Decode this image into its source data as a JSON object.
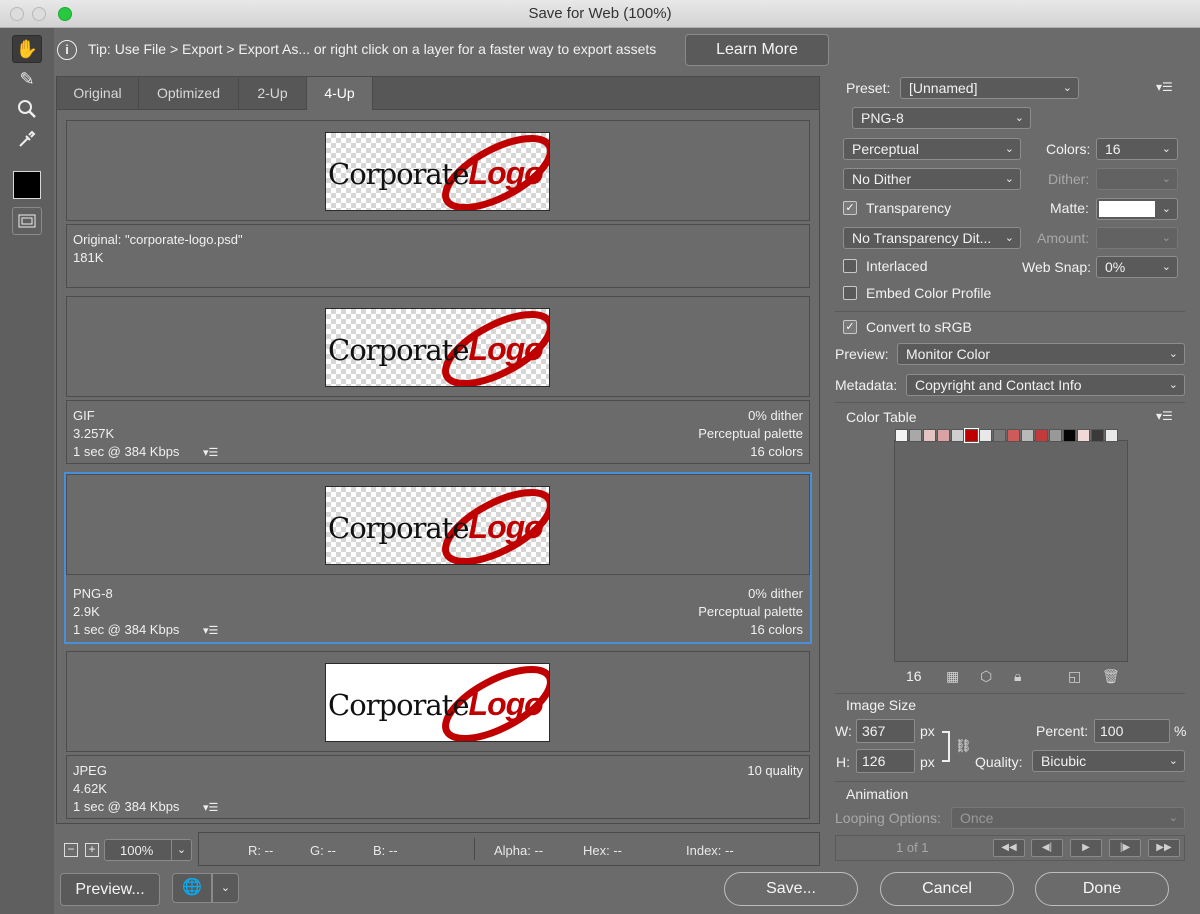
{
  "window": {
    "title": "Save for Web (100%)"
  },
  "tools": [
    "hand-tool-icon",
    "slice-select-tool-icon",
    "zoom-tool-icon",
    "eyedropper-tool-icon"
  ],
  "tip": {
    "text": "Tip: Use File > Export > Export As...  or right click on a layer for a faster way to export assets",
    "learn_more": "Learn More"
  },
  "tabs": [
    "Original",
    "Optimized",
    "2-Up",
    "4-Up"
  ],
  "active_tab": "4-Up",
  "panes": [
    {
      "logo_text_a": "Corporate",
      "logo_text_b": "Logo",
      "left": [
        "Original: \"corporate-logo.psd\"",
        "181K",
        ""
      ],
      "right": [
        "",
        "",
        ""
      ]
    },
    {
      "logo_text_a": "Corporate",
      "logo_text_b": "Logo",
      "left": [
        "GIF",
        "3.257K",
        "1 sec @ 384 Kbps"
      ],
      "right": [
        "0% dither",
        "Perceptual palette",
        "16 colors"
      ]
    },
    {
      "logo_text_a": "Corporate",
      "logo_text_b": "Logo",
      "left": [
        "PNG-8",
        "2.9K",
        "1 sec @ 384 Kbps"
      ],
      "right": [
        "0% dither",
        "Perceptual palette",
        "16 colors"
      ]
    },
    {
      "logo_text_a": "Corporate",
      "logo_text_b": "Logo",
      "left": [
        "JPEG",
        "4.62K",
        "1 sec @ 384 Kbps"
      ],
      "right": [
        "10 quality",
        "",
        ""
      ]
    }
  ],
  "bottom": {
    "zoom": "100%",
    "r": "R: --",
    "g": "G: --",
    "b": "B: --",
    "alpha": "Alpha: --",
    "hex": "Hex: --",
    "index": "Index: --"
  },
  "buttons": {
    "preview": "Preview...",
    "save": "Save...",
    "cancel": "Cancel",
    "done": "Done"
  },
  "settings": {
    "preset_label": "Preset:",
    "preset_value": "[Unnamed]",
    "format": "PNG-8",
    "reduction": "Perceptual",
    "colors_label": "Colors:",
    "colors_value": "16",
    "dither_algo": "No Dither",
    "dither_label": "Dither:",
    "transparency_label": "Transparency",
    "transparency_checked": true,
    "matte_label": "Matte:",
    "transparency_dither": "No Transparency Dit...",
    "amount_label": "Amount:",
    "interlaced_label": "Interlaced",
    "interlaced_checked": false,
    "websnap_label": "Web Snap:",
    "websnap_value": "0%",
    "embed_label": "Embed Color Profile",
    "embed_checked": false,
    "srgb_label": "Convert to sRGB",
    "srgb_checked": true,
    "preview_label": "Preview:",
    "preview_value": "Monitor Color",
    "metadata_label": "Metadata:",
    "metadata_value": "Copyright and Contact Info"
  },
  "color_table": {
    "title": "Color Table",
    "count": "16",
    "swatches": [
      "#f4f4f4",
      "#a8a8a8",
      "#e4c3c3",
      "#d9a3a3",
      "#cfcfcf",
      "#c00000",
      "#e8e8e8",
      "#7a7a7a",
      "#cf5a5a",
      "#b9b9b9",
      "#c23a3a",
      "#999999",
      "#050505",
      "#f0d8d8",
      "#3a3a3a",
      "#e9e9e9"
    ]
  },
  "image_size": {
    "title": "Image Size",
    "w_label": "W:",
    "w_value": "367",
    "h_label": "H:",
    "h_value": "126",
    "unit": "px",
    "percent_label": "Percent:",
    "percent_value": "100",
    "percent_unit": "%",
    "quality_label": "Quality:",
    "quality_value": "Bicubic"
  },
  "animation": {
    "title": "Animation",
    "looping_label": "Looping Options:",
    "looping_value": "Once",
    "frame": "1 of 1"
  }
}
